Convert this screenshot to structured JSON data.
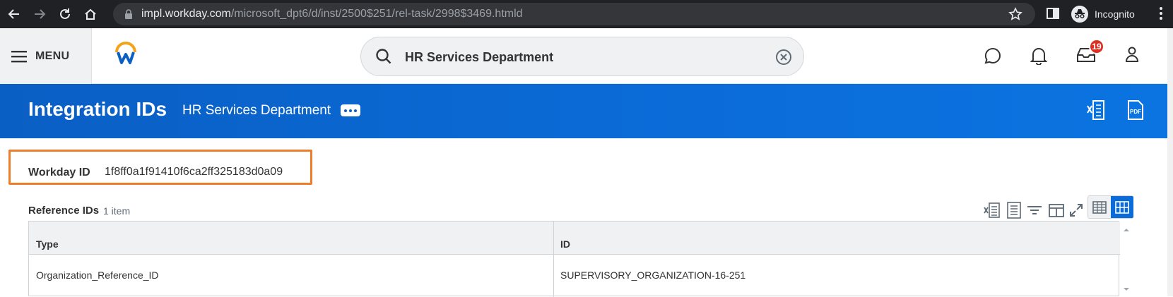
{
  "browser": {
    "url_host": "impl.workday.com",
    "url_path": "/microsoft_dpt6/d/inst/2500$251/rel-task/2998$3469.htmld",
    "profile_label": "Incognito"
  },
  "header": {
    "menu_label": "MENU",
    "search_value": "HR Services Department",
    "inbox_badge": "19"
  },
  "band": {
    "title": "Integration IDs",
    "subtitle": "HR Services Department",
    "export_excel_icon": "excel-export-icon",
    "export_pdf_icon": "pdf-export-icon"
  },
  "workday_id": {
    "label": "Workday ID",
    "value": "1f8ff0a1f91410f6ca2ff325183d0a09"
  },
  "reference_ids": {
    "title": "Reference IDs",
    "count": "1 item",
    "columns": [
      "Type",
      "ID"
    ],
    "rows": [
      [
        "Organization_Reference_ID",
        "SUPERVISORY_ORGANIZATION-16-251"
      ]
    ]
  },
  "colors": {
    "band_blue": "#0b6cd9",
    "highlight_orange": "#ee7d2b",
    "badge_red": "#de2e21"
  }
}
